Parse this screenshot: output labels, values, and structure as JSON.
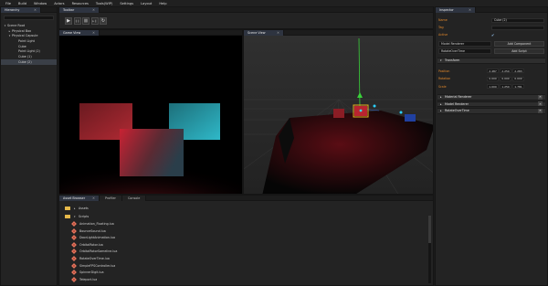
{
  "menu": [
    "File",
    "Build",
    "Window",
    "Actors",
    "Resources",
    "Tools(WIP)",
    "Settings",
    "Layout",
    "Help"
  ],
  "hierarchy": {
    "tab": "Hierarchy",
    "items": [
      {
        "label": "Scene Root",
        "caret": "▾"
      },
      {
        "label": "Physical Box",
        "caret": "▸"
      },
      {
        "label": "Physical Capsule",
        "caret": "▾"
      },
      {
        "label": "Point Light",
        "caret": ""
      },
      {
        "label": "Cube",
        "caret": ""
      },
      {
        "label": "Point Light (2)",
        "caret": ""
      },
      {
        "label": "Cube (1)",
        "caret": ""
      },
      {
        "label": "Cube (2)",
        "caret": ""
      }
    ]
  },
  "toolbar": {
    "tab": "Toolbar",
    "play": "▶",
    "pause": "❚❚",
    "stop": "■",
    "next": "▶❚",
    "refresh": "↻"
  },
  "game_view": {
    "tab": "Game View"
  },
  "scene_view": {
    "tab": "Scene View"
  },
  "inspector": {
    "tab": "Inspector",
    "name_label": "Name",
    "name_value": "Cube (2)",
    "tag_label": "Tag",
    "tag_value": "",
    "active_label": "Active",
    "active_check": "✔",
    "component_select": "Model Renderer",
    "add_component": "Add Component",
    "script_field": "RotateOverTime",
    "add_script": "Add Script",
    "transform": {
      "title": "Transform",
      "position_label": "Position",
      "position": [
        "2.487",
        "2.250",
        "2.283"
      ],
      "rotation_label": "Rotation",
      "rotation": [
        "0.000",
        "0.000",
        "0.000"
      ],
      "scale_label": "Scale",
      "scale": [
        "1.000",
        "1.250",
        "1.781"
      ]
    },
    "components": [
      "Material Renderer",
      "Model Renderer",
      "RotateOverTime"
    ],
    "close_glyph": "✕"
  },
  "assets": {
    "tabs": [
      "Asset Browser",
      "Profiler",
      "Console"
    ],
    "rows": [
      {
        "type": "folder",
        "label": "Assets"
      },
      {
        "type": "folder",
        "label": "Scripts"
      },
      {
        "type": "lua",
        "label": "Animation_Floating.lua"
      },
      {
        "type": "lua",
        "label": "BounceSound.lua"
      },
      {
        "type": "lua",
        "label": "DoorLightAnimation.lua"
      },
      {
        "type": "lua",
        "label": "OrbitalRotor.lua"
      },
      {
        "type": "lua",
        "label": "OrbitalRotorSameline.lua"
      },
      {
        "type": "lua",
        "label": "RotateOverTime.lua"
      },
      {
        "type": "lua",
        "label": "SimpleFPSController.lua"
      },
      {
        "type": "lua",
        "label": "SpinnerDigit.lua"
      },
      {
        "type": "lua",
        "label": "Teleport.lua"
      }
    ]
  },
  "colors": {
    "accent_label": "#e0872b",
    "active_tab": "#2e3440",
    "folder": "#e6b94a",
    "lua_icon": "#b84a3a"
  }
}
